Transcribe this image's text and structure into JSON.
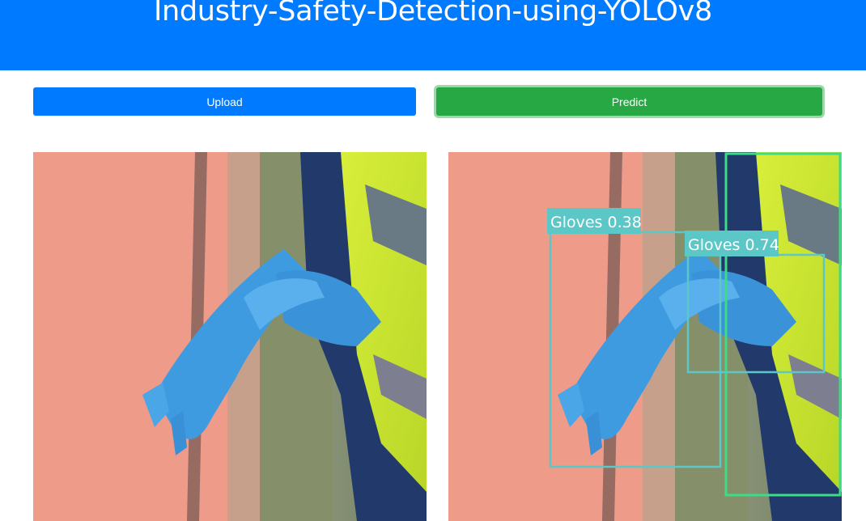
{
  "header": {
    "title": "Industry-Safety-Detection-using-YOLOv8"
  },
  "toolbar": {
    "upload_label": "Upload",
    "predict_label": "Predict"
  },
  "colors": {
    "header_bg": "#007bff",
    "upload_button": "#007bff",
    "predict_button": "#28a745",
    "detection_box_gloves": "#5cc7c7",
    "detection_box_person": "#3ddc84"
  },
  "images": {
    "input_image": {
      "icon": "photo-worker-blue-gloves"
    },
    "result_image": {
      "icon": "photo-worker-blue-gloves-annotated"
    }
  },
  "detections": [
    {
      "label": "Gloves 0.38"
    },
    {
      "label": "Gloves 0.74"
    }
  ]
}
